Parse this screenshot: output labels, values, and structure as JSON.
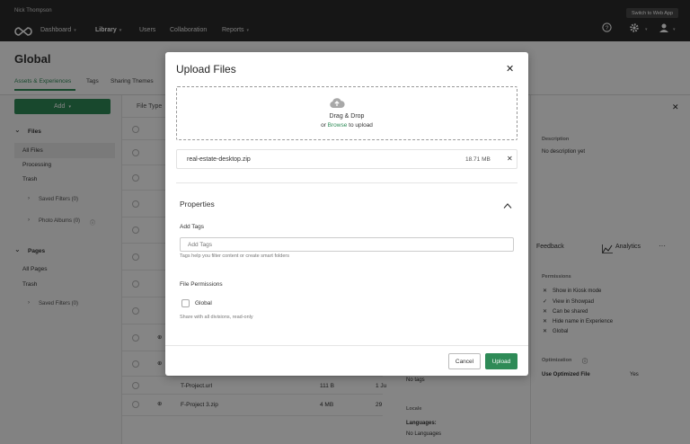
{
  "user": {
    "name": "Nick Thompson"
  },
  "topnav": {
    "items": [
      {
        "label": "Dashboard",
        "has_dropdown": true
      },
      {
        "label": "Library",
        "has_dropdown": true,
        "active": true
      },
      {
        "label": "Users",
        "has_dropdown": false
      },
      {
        "label": "Collaboration",
        "has_dropdown": false
      },
      {
        "label": "Reports",
        "has_dropdown": true
      }
    ],
    "switch_label": "Switch to Web App",
    "icons": [
      "help-icon",
      "gear-icon",
      "user-icon"
    ]
  },
  "page": {
    "title": "Global",
    "tabs": [
      {
        "label": "Assets & Experiences",
        "active": true
      },
      {
        "label": "Tags"
      },
      {
        "label": "Sharing Themes"
      }
    ]
  },
  "sidebar": {
    "add_label": "Add",
    "files_section": "Files",
    "files_items": [
      "All Files",
      "Processing",
      "Trash"
    ],
    "saved_filters": "Saved Filters (0)",
    "photo_albums": "Photo Albums (0)",
    "pages_section": "Pages",
    "pages_items": [
      "All Pages",
      "Trash"
    ],
    "pages_saved_filters": "Saved Filters (0)"
  },
  "table": {
    "file_type_header": "File Type",
    "rows": [
      {
        "name": "T-Project.url",
        "size": "111 B",
        "date": "1 Ju"
      },
      {
        "name": "F-Project 3.zip",
        "size": "4 MB",
        "date": "29"
      }
    ]
  },
  "right_panel": {
    "description_label": "Description",
    "description_text": "No description yet",
    "feedback_label": "Feedback",
    "analytics_label": "Analytics",
    "permissions_label": "Permissions",
    "permissions": [
      {
        "mark": "✕",
        "label": "Show in Kiosk mode"
      },
      {
        "mark": "✓",
        "label": "View in Showpad"
      },
      {
        "mark": "✕",
        "label": "Can be shared"
      },
      {
        "mark": "✕",
        "label": "Hide name in Experience"
      },
      {
        "mark": "✕",
        "label": "Global"
      }
    ],
    "optimization_label": "Optimization",
    "use_optimized_label": "Use Optimized File",
    "use_optimized_value": "Yes",
    "no_tags": "No tags",
    "locale_label": "Locale",
    "languages_label": "Languages:",
    "languages_value": "No Languages"
  },
  "modal": {
    "title": "Upload Files",
    "drop_text": "Drag & Drop",
    "or_text": "or",
    "browse_text": "Browse",
    "to_upload_text": "to upload",
    "file": {
      "name": "real-estate-desktop.zip",
      "size": "18.71 MB"
    },
    "properties_label": "Properties",
    "add_tags_label": "Add Tags",
    "add_tags_placeholder": "Add Tags",
    "tags_help": "Tags help you filter content or create smart folders",
    "file_permissions_label": "File Permissions",
    "global_label": "Global",
    "global_help": "Share with all divisions, read-only",
    "cancel_label": "Cancel",
    "upload_label": "Upload"
  },
  "colors": {
    "accent": "#2e8b57",
    "topbar": "#2b2b2b",
    "overlay": "rgba(0,0,0,0.48)"
  }
}
